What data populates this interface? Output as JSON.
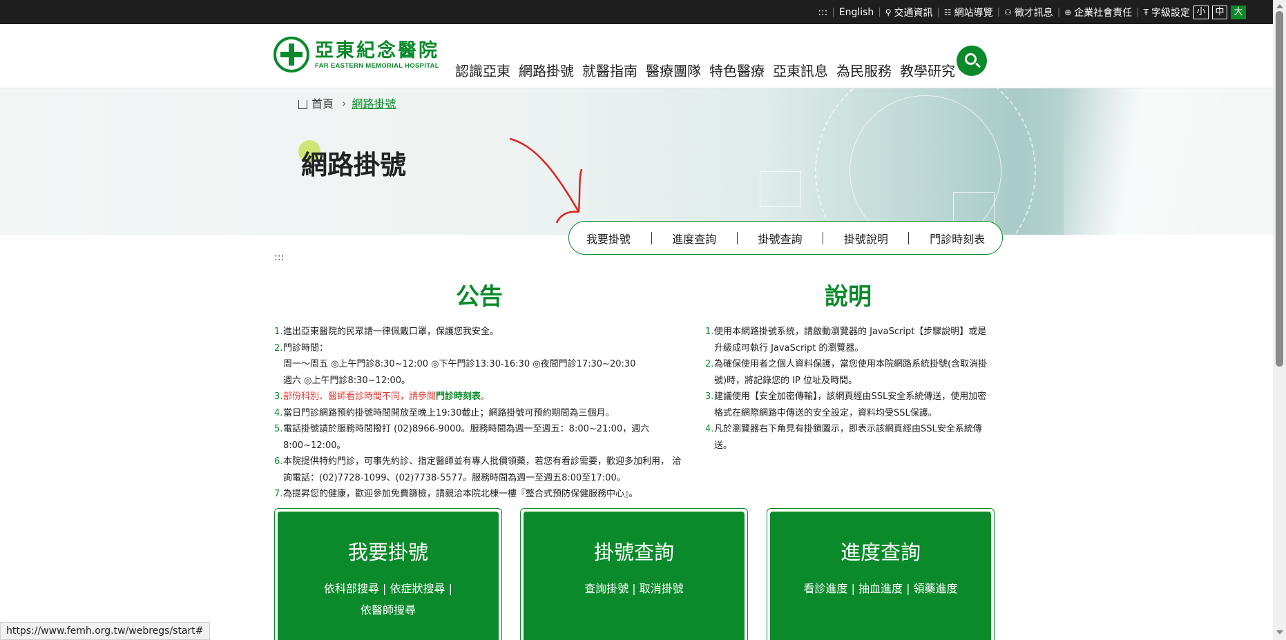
{
  "topbar": {
    "skip": ":::",
    "english": "English",
    "traffic": "交通資訊",
    "sitemap": "網站導覽",
    "jobs": "徵才訊息",
    "csr": "企業社會責任",
    "font_size": "字級設定",
    "size_small": "小",
    "size_medium": "中",
    "size_large": "大"
  },
  "logo": {
    "cn": "亞東紀念醫院",
    "en": "FAR EASTERN MEMORIAL HOSPITAL"
  },
  "nav": [
    "認識亞東",
    "網路掛號",
    "就醫指南",
    "醫療團隊",
    "特色醫療",
    "亞東訊息",
    "為民服務",
    "教學研究"
  ],
  "breadcrumb": {
    "home": "首頁",
    "current": "網路掛號"
  },
  "page_title": "網路掛號",
  "subtabs": [
    "我要掛號",
    "進度查詢",
    "掛號查詢",
    "掛號說明",
    "門診時刻表"
  ],
  "skip_link": ":::",
  "announcement": {
    "title": "公告",
    "items": [
      {
        "num": "1.",
        "text": "進出亞東醫院的民眾請一律佩戴口罩，保護您我安全。"
      },
      {
        "num": "2.",
        "text": "門診時間："
      },
      {
        "num": "",
        "text": "周一～周五 ◎上午門診8:30~12:00 ◎下午門診13:30-16:30 ◎夜間門診17:30~20:30"
      },
      {
        "num": "",
        "text": "週六 ◎上午門診8:30~12:00。"
      },
      {
        "num": "3.",
        "red": "部份科別、醫師看診時間不同，請參閱",
        "link": "門診時刻表",
        "end": "。"
      },
      {
        "num": "4.",
        "text": "當日門診網路預約掛號時間開放至晚上19:30截止；網路掛號可預約期間為三個月。"
      },
      {
        "num": "5.",
        "text": "電話掛號請於服務時間撥打 (02)8966-9000。服務時間為週一至週五：8:00~21:00，週六"
      },
      {
        "num": "",
        "text": "8:00~12:00。"
      },
      {
        "num": "6.",
        "text": "本院提供特約門診，可事先約診、指定醫師並有專人批價領藥，若您有看診需要，歡迎多加利用， 洽"
      },
      {
        "num": "",
        "text": "詢電話：(02)7728-1099、(02)7738-5577。服務時間為週一至週五8:00至17:00。"
      },
      {
        "num": "7.",
        "text": "為提昇您的健康，歡迎參加免費篩檢，請親洽本院北棟一樓『整合式預防保健服務中心』。"
      }
    ]
  },
  "explanation": {
    "title": "說明",
    "items": [
      {
        "num": "1.",
        "lines": [
          "使用本網路掛號系統，請啟動瀏覽器的 JavaScript【步驟說明】或是",
          "升級成可執行 JavaScript 的瀏覽器。"
        ]
      },
      {
        "num": "2.",
        "lines": [
          "為確保使用者之個人資料保護，當您使用本院網路系統掛號(含取消掛",
          "號)時，將記錄您的 IP 位址及時間。"
        ]
      },
      {
        "num": "3.",
        "lines": [
          "建議使用【安全加密傳輸】，該網頁經由SSL安全系統傳送，使用加密",
          "格式在網際網路中傳送的安全設定，資料均受SSL保護。"
        ]
      },
      {
        "num": "4.",
        "lines": [
          "凡於瀏覽器右下角見有掛鎖圖示，即表示該網頁經由SSL安全系統傳",
          "送。"
        ]
      }
    ]
  },
  "cards": [
    {
      "title": "我要掛號",
      "links_line1": "依科部搜尋 | 依症狀搜尋 |",
      "links_line2": "依醫師搜尋"
    },
    {
      "title": "掛號查詢",
      "links_line1": "查詢掛號 | 取消掛號",
      "links_line2": ""
    },
    {
      "title": "進度查詢",
      "links_line1": "看診進度 | 抽血進度 | 領藥進度",
      "links_line2": ""
    }
  ],
  "status_url": "https://www.femh.org.tw/webregs/start#",
  "colors": {
    "brand_green": "#0a8a2a",
    "topbar": "#1e1e1e",
    "notice_red": "#e53935",
    "annotation_arrow": "#e02020"
  }
}
